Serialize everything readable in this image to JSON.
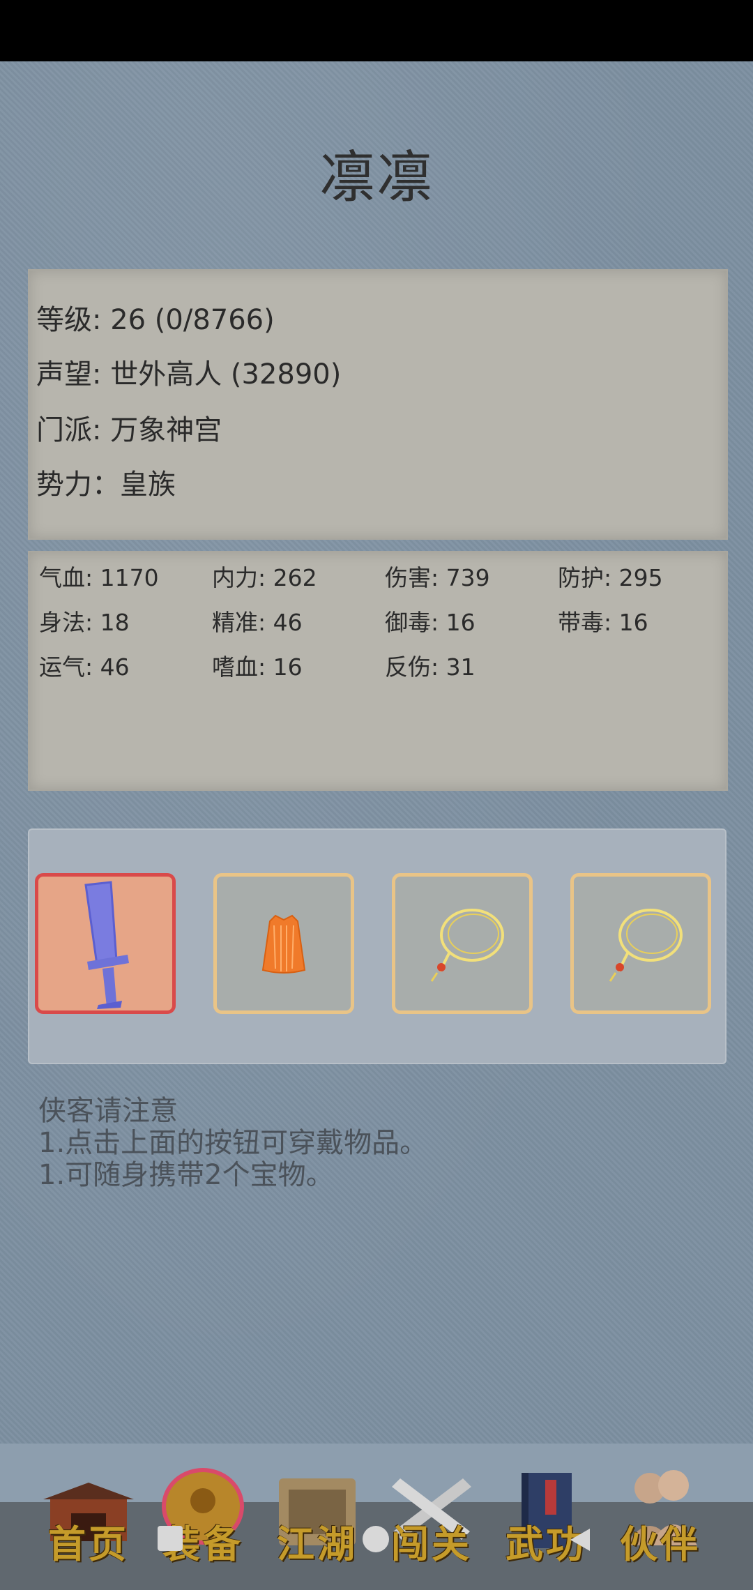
{
  "title": "凛凛",
  "info": {
    "level": "等级: 26 (0/8766)",
    "reputation": "声望: 世外高人 (32890)",
    "sect": "门派: 万象神宫",
    "faction": "势力：皇族"
  },
  "stats": [
    [
      "气血: 1170",
      "内力: 262",
      "伤害: 739",
      "防护: 295"
    ],
    [
      "身法: 18",
      "精准: 46",
      "御毒: 16",
      "带毒: 16"
    ],
    [
      "运气: 46",
      "嗜血: 16",
      "反伤: 31",
      ""
    ]
  ],
  "equipment": {
    "slots": [
      {
        "item": "sword-icon",
        "border_color": "#d94a4a",
        "bg_color": "#e6a587"
      },
      {
        "item": "robe-icon",
        "border_color": "#e9c487",
        "bg_color": "#a8adab"
      },
      {
        "item": "necklace-icon",
        "border_color": "#e9c487",
        "bg_color": "#a8adab"
      },
      {
        "item": "necklace-icon",
        "border_color": "#e9c487",
        "bg_color": "#a8adab"
      }
    ]
  },
  "notice": {
    "heading": "侠客请注意",
    "line1": "1.点击上面的按钮可穿戴物品。",
    "line2": "1.可随身携带2个宝物。"
  },
  "nav": [
    {
      "label": "首页",
      "icon": "temple-icon"
    },
    {
      "label": "装备",
      "icon": "armor-icon"
    },
    {
      "label": "江湖",
      "icon": "scroll-icon"
    },
    {
      "label": "闯关",
      "icon": "crossed-swords-icon"
    },
    {
      "label": "武功",
      "icon": "book-icon"
    },
    {
      "label": "伙伴",
      "icon": "companions-icon"
    }
  ],
  "colors": {
    "background": "#7d90a1",
    "panel": "#b7b5ad",
    "nav_label": "#c59b2a"
  }
}
